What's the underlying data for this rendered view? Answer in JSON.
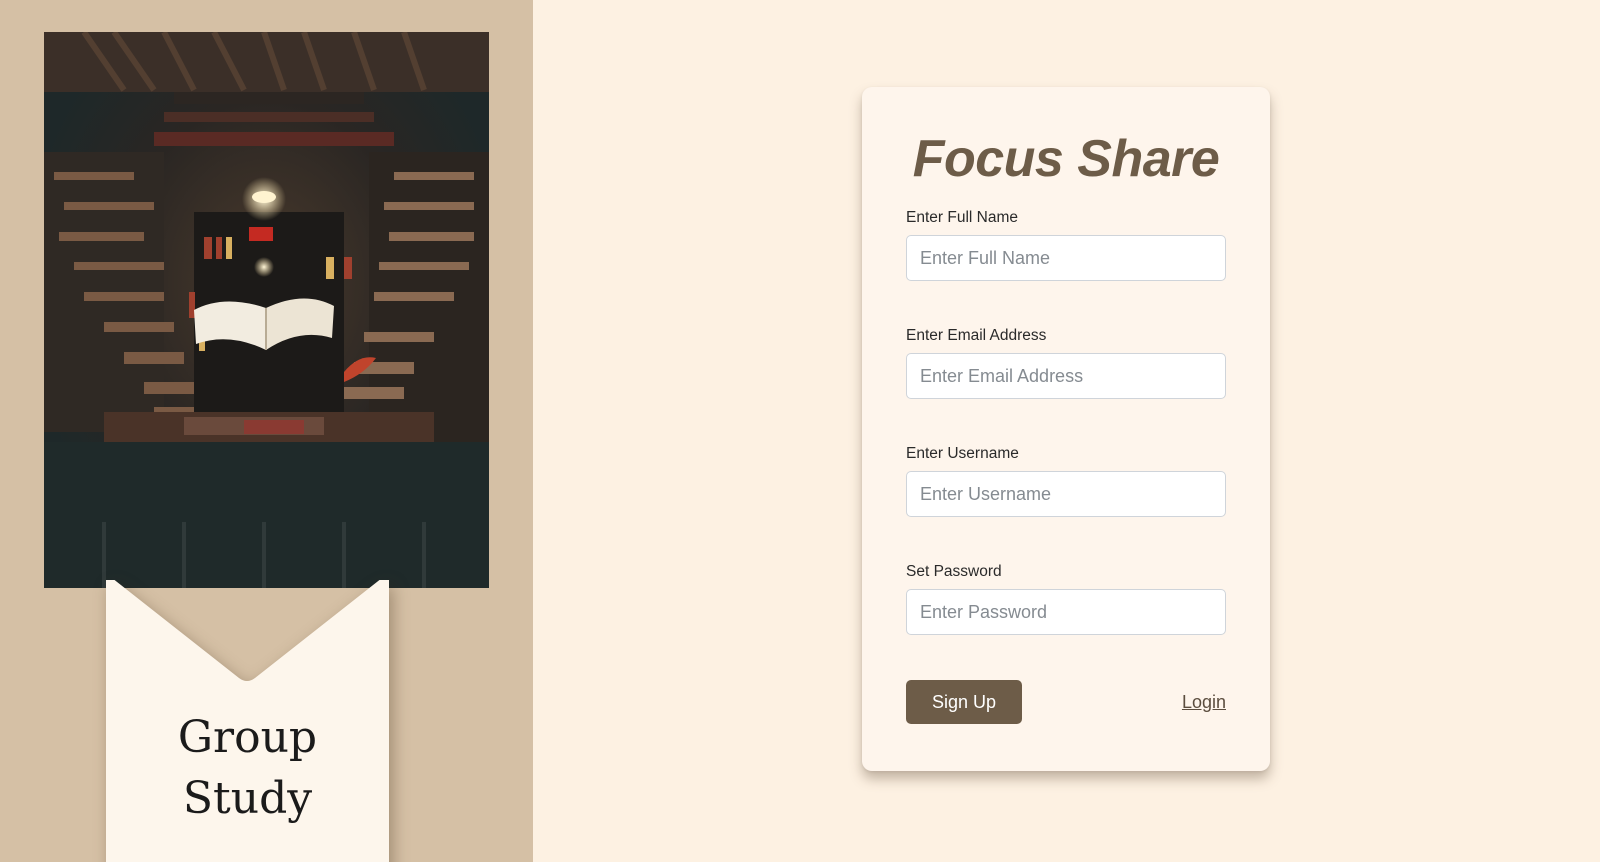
{
  "banner": {
    "title_line1": "Group",
    "title_line2": "Study"
  },
  "form": {
    "brand": "Focus Share",
    "fields": [
      {
        "label": "Enter Full Name",
        "placeholder": "Enter Full Name",
        "value": ""
      },
      {
        "label": "Enter Email Address",
        "placeholder": "Enter Email Address",
        "value": ""
      },
      {
        "label": "Enter Username",
        "placeholder": "Enter Username",
        "value": ""
      },
      {
        "label": "Set Password",
        "placeholder": "Enter Password",
        "value": ""
      }
    ],
    "signup_label": "Sign Up",
    "login_label": "Login"
  },
  "colors": {
    "page_background": "#fdf1e2",
    "left_panel": "#d5c0a5",
    "brand_text": "#6d5c48",
    "button": "#6d5c48",
    "card": "#fef5ec"
  }
}
